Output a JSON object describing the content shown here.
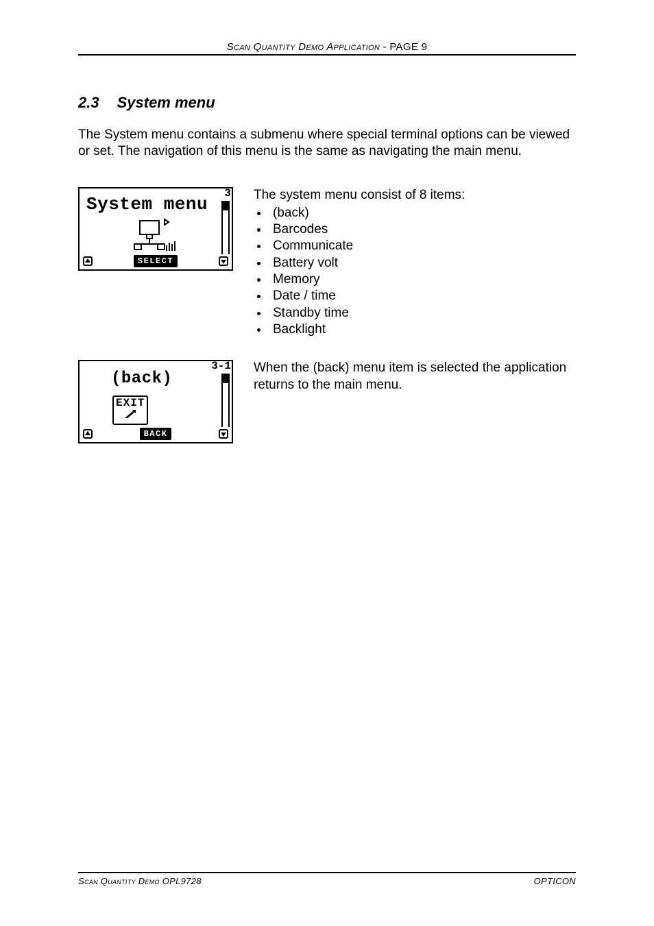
{
  "header": {
    "title_italic": "Scan Quantity Demo Application",
    "sep": "    -    ",
    "page_label": "PAGE 9"
  },
  "section": {
    "number": "2.3",
    "title": "System menu"
  },
  "intro": "The System menu contains a submenu where special terminal options can be viewed or set. The navigation of this menu is the same as navigating the main menu.",
  "block1": {
    "lcd": {
      "corner": "3",
      "title": "System menu",
      "bottom_label": "SELECT"
    },
    "lead": "The system menu consist of 8 items:",
    "items": [
      "(back)",
      "Barcodes",
      "Communicate",
      "Battery volt",
      "Memory",
      "Date / time",
      "Standby time",
      "Backlight"
    ]
  },
  "block2": {
    "lcd": {
      "corner": "3-1",
      "title": "(back)",
      "exit_label": "EXIT",
      "bottom_label": "BACK"
    },
    "text": "When the (back) menu item is selected the application returns to the main menu."
  },
  "footer": {
    "left": "Scan Quantity Demo OPL9728",
    "right": "OPTICON"
  }
}
